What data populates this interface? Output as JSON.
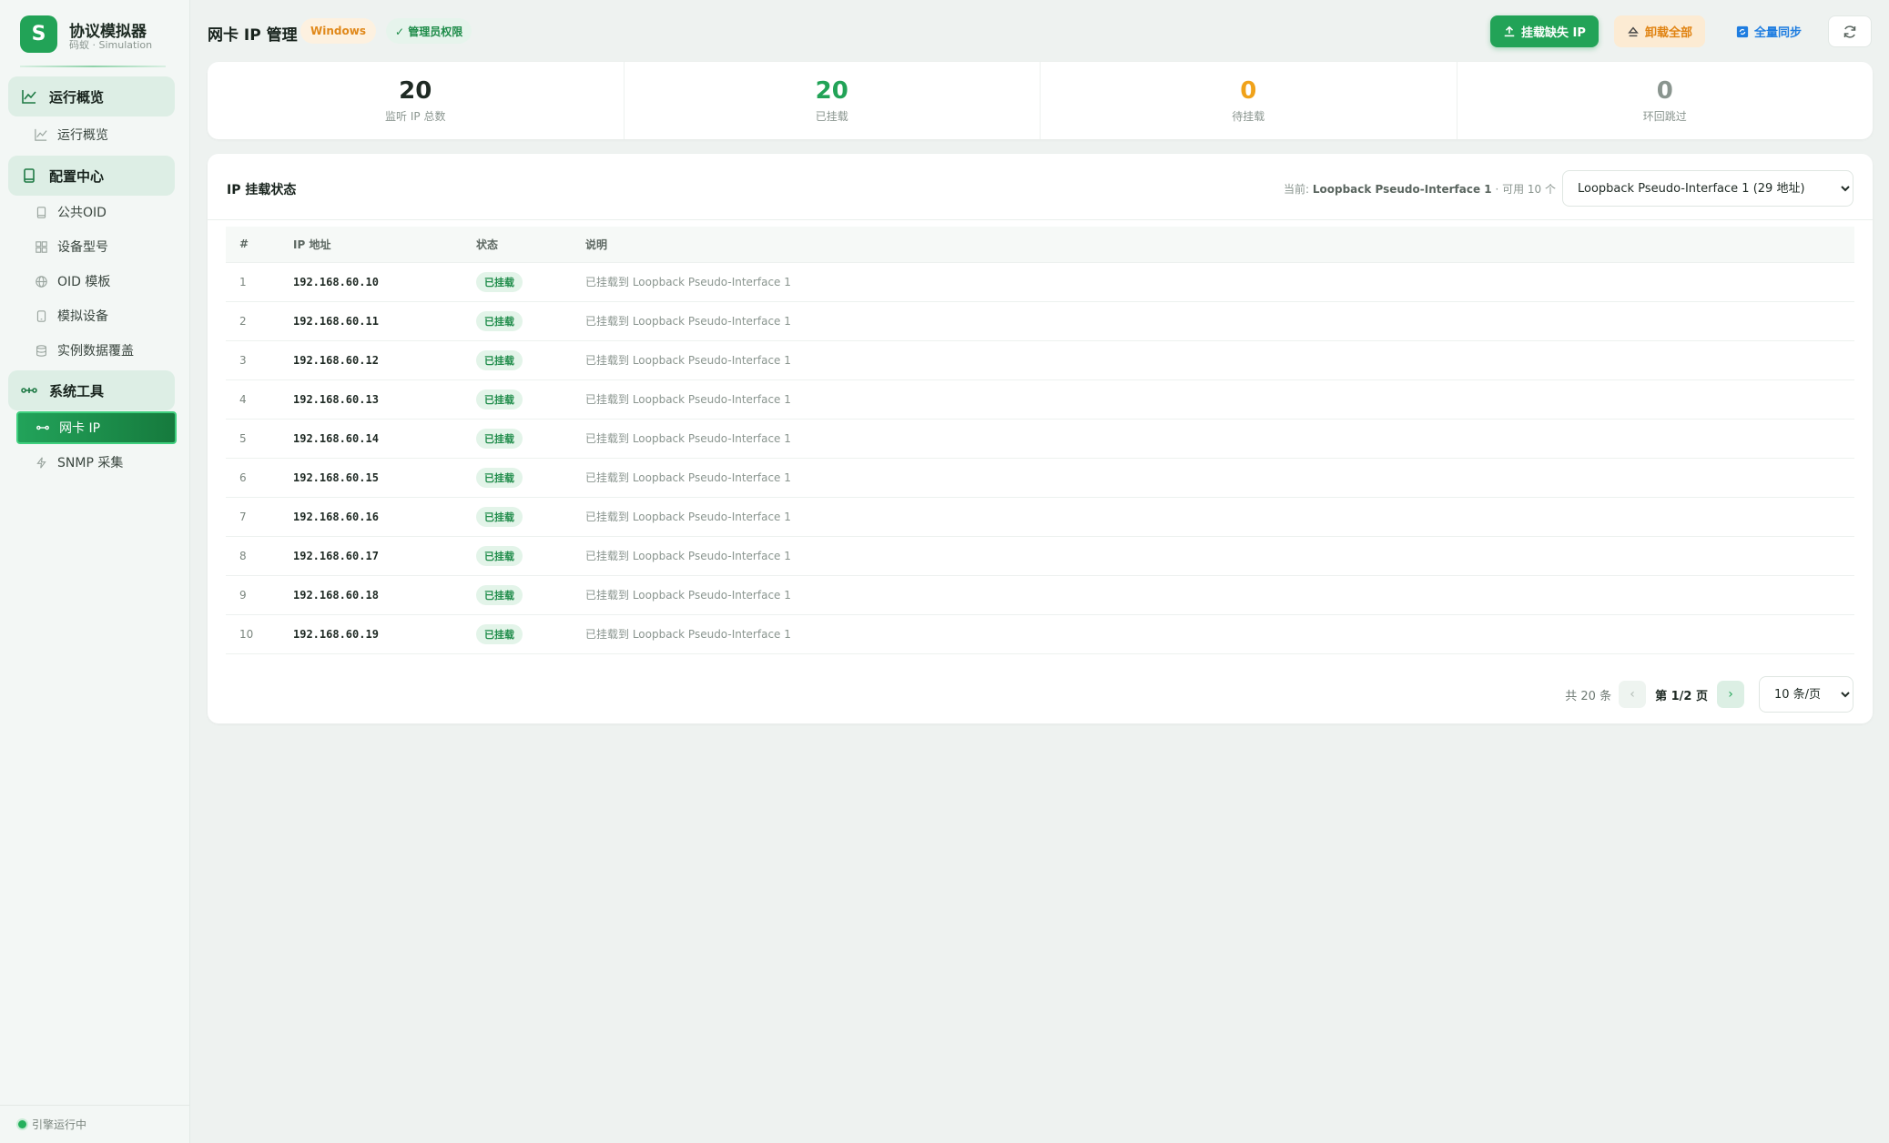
{
  "brand": {
    "logo_letter": "S",
    "title": "协议模拟器",
    "subtitle": "码蚁 · Simulation"
  },
  "sidebar": {
    "groups": [
      {
        "label": "运行概览",
        "icon": "chart-line-icon",
        "items": [
          {
            "label": "运行概览",
            "icon": "chart-line-icon"
          }
        ]
      },
      {
        "label": "配置中心",
        "icon": "book-icon",
        "items": [
          {
            "label": "公共OID",
            "icon": "document-icon"
          },
          {
            "label": "设备型号",
            "icon": "grid-icon"
          },
          {
            "label": "OID 模板",
            "icon": "globe-icon"
          },
          {
            "label": "模拟设备",
            "icon": "device-icon"
          },
          {
            "label": "实例数据覆盖",
            "icon": "database-icon"
          }
        ]
      },
      {
        "label": "系统工具",
        "icon": "network-icon",
        "items": [
          {
            "label": "网卡 IP",
            "icon": "network-icon",
            "active": true
          },
          {
            "label": "SNMP 采集",
            "icon": "bolt-icon"
          }
        ]
      }
    ],
    "footer_status": "引擎运行中"
  },
  "header": {
    "title": "网卡 IP 管理",
    "os_badge": "Windows",
    "admin_badge": "✓ 管理员权限",
    "actions": {
      "mount_missing": "挂载缺失 IP",
      "unmount_all": "卸载全部",
      "full_sync": "全量同步"
    }
  },
  "stats": [
    {
      "value": "20",
      "label": "监听 IP 总数",
      "color": "#1f2a24"
    },
    {
      "value": "20",
      "label": "已挂载",
      "color": "#22a357"
    },
    {
      "value": "0",
      "label": "待挂载",
      "color": "#f0a21a"
    },
    {
      "value": "0",
      "label": "环回跳过",
      "color": "#8a958f"
    }
  ],
  "card": {
    "title": "IP 挂载状态",
    "meta_prefix": "当前: ",
    "meta_iface": "Loopback Pseudo-Interface 1",
    "meta_suffix": " · 可用 10 个",
    "iface_selected": "Loopback Pseudo-Interface 1 (29 地址)"
  },
  "table": {
    "columns": [
      "#",
      "IP 地址",
      "状态",
      "说明"
    ],
    "rows": [
      {
        "idx": "1",
        "ip": "192.168.60.10",
        "status": "已挂载",
        "desc": "已挂载到 Loopback Pseudo-Interface 1"
      },
      {
        "idx": "2",
        "ip": "192.168.60.11",
        "status": "已挂载",
        "desc": "已挂载到 Loopback Pseudo-Interface 1"
      },
      {
        "idx": "3",
        "ip": "192.168.60.12",
        "status": "已挂载",
        "desc": "已挂载到 Loopback Pseudo-Interface 1"
      },
      {
        "idx": "4",
        "ip": "192.168.60.13",
        "status": "已挂载",
        "desc": "已挂载到 Loopback Pseudo-Interface 1"
      },
      {
        "idx": "5",
        "ip": "192.168.60.14",
        "status": "已挂载",
        "desc": "已挂载到 Loopback Pseudo-Interface 1"
      },
      {
        "idx": "6",
        "ip": "192.168.60.15",
        "status": "已挂载",
        "desc": "已挂载到 Loopback Pseudo-Interface 1"
      },
      {
        "idx": "7",
        "ip": "192.168.60.16",
        "status": "已挂载",
        "desc": "已挂载到 Loopback Pseudo-Interface 1"
      },
      {
        "idx": "8",
        "ip": "192.168.60.17",
        "status": "已挂载",
        "desc": "已挂载到 Loopback Pseudo-Interface 1"
      },
      {
        "idx": "9",
        "ip": "192.168.60.18",
        "status": "已挂载",
        "desc": "已挂载到 Loopback Pseudo-Interface 1"
      },
      {
        "idx": "10",
        "ip": "192.168.60.19",
        "status": "已挂载",
        "desc": "已挂载到 Loopback Pseudo-Interface 1"
      }
    ]
  },
  "pagination": {
    "total": "共 20 条",
    "prev": "‹",
    "next": "›",
    "page_info": "第 1/2 页",
    "page_size": "10 条/页"
  }
}
